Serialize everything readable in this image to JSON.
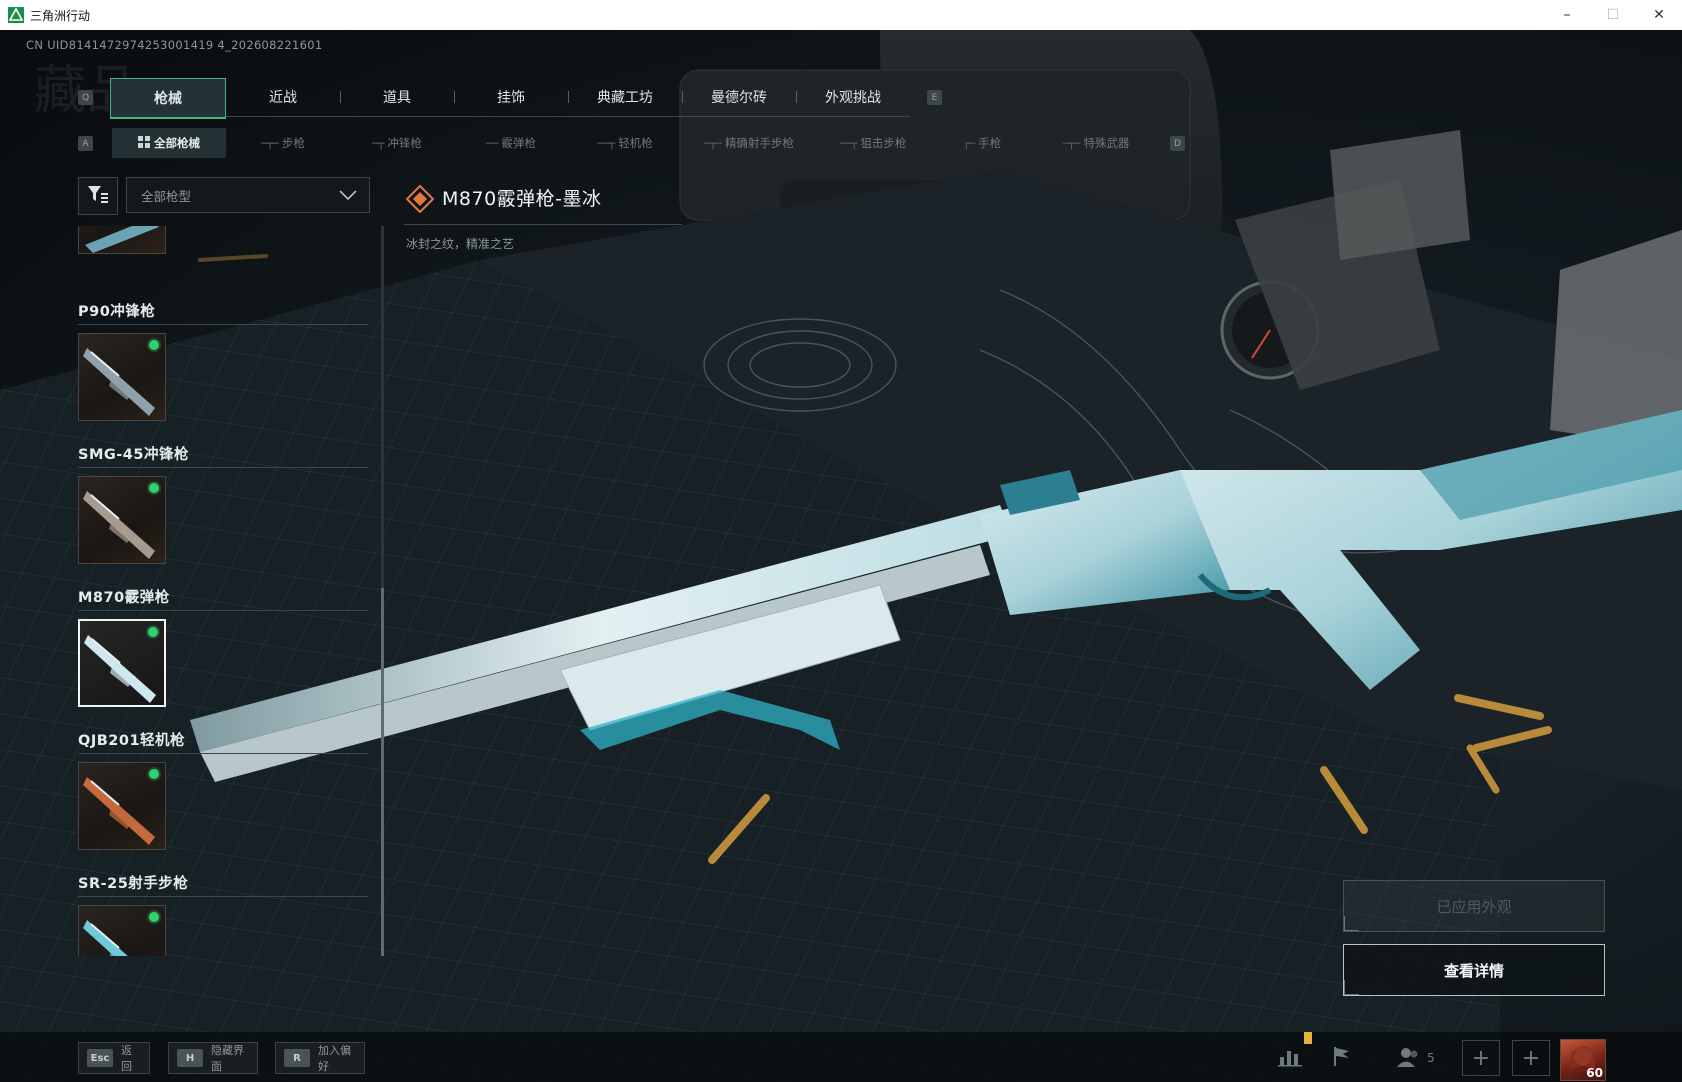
{
  "window": {
    "title": "三角洲行动"
  },
  "uid": "CN UID8141472974253001419 4_202608221601",
  "ghost_title": "藏品",
  "main_tabs": {
    "left_key": "Q",
    "right_key": "E",
    "items": [
      {
        "label": "枪械",
        "active": true
      },
      {
        "label": "近战"
      },
      {
        "label": "道具"
      },
      {
        "label": "挂饰"
      },
      {
        "label": "典藏工坊"
      },
      {
        "label": "曼德尔砖"
      },
      {
        "label": "外观挑战"
      }
    ]
  },
  "sub_tabs": {
    "left_key": "A",
    "right_key": "D",
    "items": [
      {
        "label": "全部枪械",
        "active": true
      },
      {
        "label": "步枪"
      },
      {
        "label": "冲锋枪"
      },
      {
        "label": "霰弹枪"
      },
      {
        "label": "轻机枪"
      },
      {
        "label": "精确射手步枪"
      },
      {
        "label": "狙击步枪"
      },
      {
        "label": "手枪"
      },
      {
        "label": "特殊武器"
      }
    ]
  },
  "filter": {
    "select_value": "全部枪型"
  },
  "weapons": [
    {
      "name": "P90冲锋枪",
      "owned": true,
      "selected": false,
      "tint": "#8fa1aa"
    },
    {
      "name": "SMG-45冲锋枪",
      "owned": true,
      "selected": false,
      "tint": "#a79a8e"
    },
    {
      "name": "M870霰弹枪",
      "owned": true,
      "selected": true,
      "tint": "#cfe8ee"
    },
    {
      "name": "QJB201轻机枪",
      "owned": true,
      "selected": false,
      "tint": "#c46a3c"
    },
    {
      "name": "SR-25射手步枪",
      "owned": true,
      "selected": false,
      "tint": "#6fc9d8"
    }
  ],
  "detail": {
    "title": "M870霰弹枪-墨冰",
    "subtitle": "冰封之纹，精准之艺",
    "rarity_color": "#e07a3a"
  },
  "actions": {
    "applied_label": "已应用外观",
    "details_label": "查看详情"
  },
  "bottom_hints": [
    {
      "key": "Esc",
      "label": "返回"
    },
    {
      "key": "H",
      "label": "隐藏界面"
    },
    {
      "key": "R",
      "label": "加入偏好"
    }
  ],
  "tray": {
    "party_count": "5",
    "level": "60"
  },
  "colors": {
    "accent_green": "#4ab37c",
    "owned_dot": "#2fd26c",
    "ice": "#bfe3ea",
    "ice_dark": "#3a8fa0"
  }
}
